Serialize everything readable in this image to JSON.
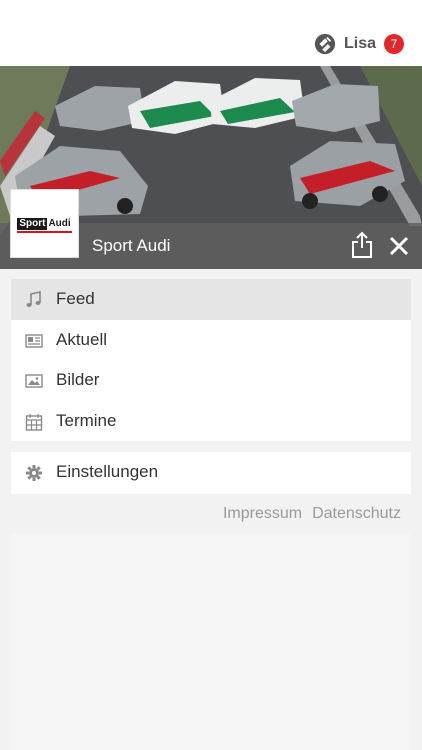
{
  "header": {
    "user_name": "Lisa",
    "notification_count": "7"
  },
  "page": {
    "title": "Sport Audi",
    "logo_text_part1": "Sport",
    "logo_text_part2": "Audi"
  },
  "menu": {
    "items": [
      {
        "label": "Feed",
        "icon": "music-note-icon",
        "active": true
      },
      {
        "label": "Aktuell",
        "icon": "newspaper-icon",
        "active": false
      },
      {
        "label": "Bilder",
        "icon": "image-icon",
        "active": false
      },
      {
        "label": "Termine",
        "icon": "calendar-icon",
        "active": false
      }
    ],
    "settings_label": "Einstellungen"
  },
  "footer": {
    "impressum": "Impressum",
    "datenschutz": "Datenschutz"
  },
  "colors": {
    "badge": "#e3262b",
    "active_item": "#e5e5e5",
    "titlebar": "#5f5f5f"
  }
}
